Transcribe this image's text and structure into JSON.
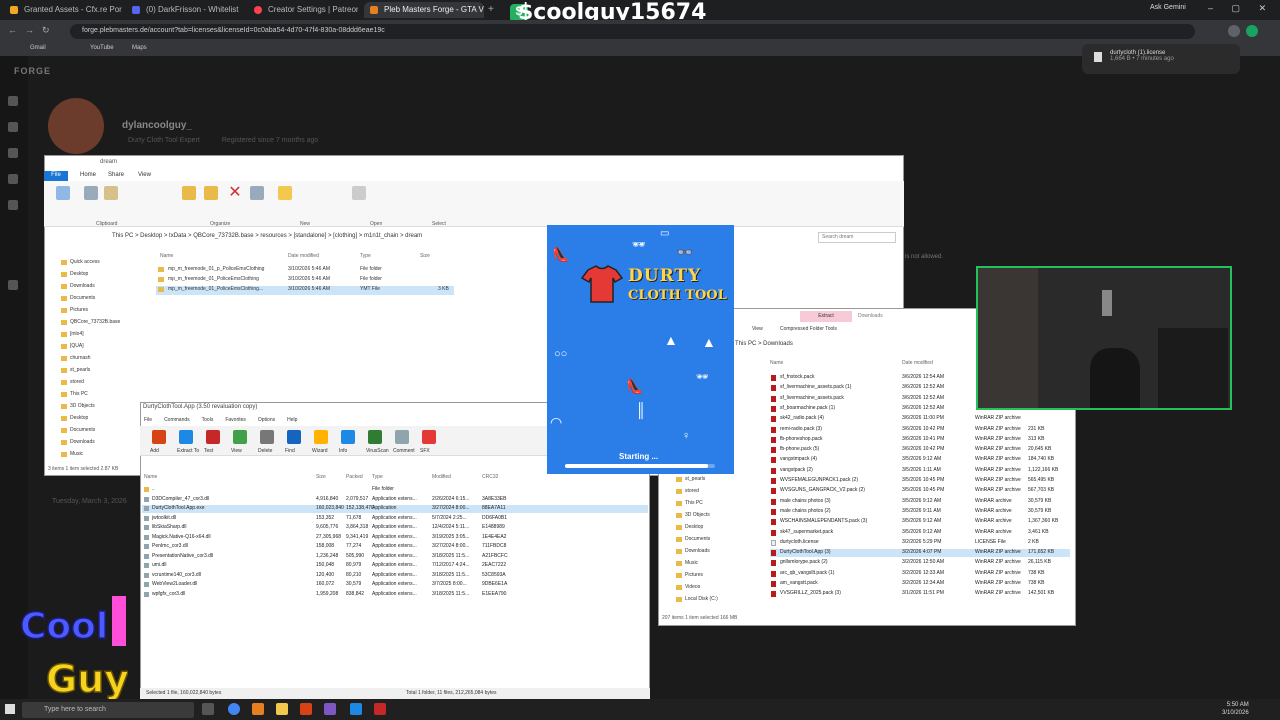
{
  "browser": {
    "tabs": [
      {
        "label": "Granted Assets - Cfx.re Portal",
        "color": "#f5a623"
      },
      {
        "label": "(0) DarkFrisson - Whitelist",
        "color": "#5865f2"
      },
      {
        "label": "Creator Settings | Patreon",
        "color": "#ff424d"
      },
      {
        "label": "Pleb Masters Forge - GTA V Du...",
        "color": "#e67e22",
        "active": true
      }
    ],
    "url": "forge.plebmasters.de/account?tab=licenses&licenseId=0c0aba54-4d70-47f4-830a-08ddd6eae19c",
    "bookmarks": [
      "Gmail",
      "YouTube",
      "Maps"
    ],
    "ask_gemini": "Ask Gemini"
  },
  "overlay": {
    "username": "$coolguy15674",
    "dollar": "$",
    "logo_top": "Cool",
    "logo_bottom": "Guy"
  },
  "site": {
    "logo": "FORGE",
    "profile_name": "dylancoolguy_",
    "badge": "Durty Cloth Tool Expert",
    "registered": "Registered since 7 months ago",
    "not_allowed": "is not allowed."
  },
  "download_popup": {
    "file": "durtycloth (1).license",
    "meta": "1,664 B • 7 minutes ago"
  },
  "explorer1": {
    "title": "dream",
    "ribbon_tabs": [
      "File",
      "Home",
      "Share",
      "View"
    ],
    "ribbon_groups": [
      "Clipboard",
      "Organize",
      "New",
      "Open",
      "Select"
    ],
    "ribbon_buttons": [
      "Pin to Quick access",
      "Copy",
      "Paste",
      "Move to",
      "Copy to",
      "Delete",
      "Rename",
      "New folder",
      "Properties"
    ],
    "path": "This PC  >  Desktop  >  txData  >  QBCore_73732B.base  >  resources  >  [standalone]  >  [clothing]  >  m1n1t_chain  >  dream",
    "search_placeholder": "Search dream",
    "nav": [
      "Quick access",
      "Desktop",
      "Downloads",
      "Documents",
      "Pictures",
      "QBCore_73732B.base",
      "[mlo4]",
      "[QUA]",
      "churnash",
      "st_pearls",
      "stored",
      "This PC",
      "3D Objects",
      "Desktop",
      "Documents",
      "Downloads",
      "Music"
    ],
    "columns": [
      "Name",
      "Date modified",
      "Type",
      "Size"
    ],
    "files": [
      {
        "name": "mp_m_freemode_01_p_PoliceEmsClothing",
        "date": "3/10/2026 5:46 AM",
        "type": "File folder",
        "size": ""
      },
      {
        "name": "mp_m_freemode_01_PoliceEmsClothing",
        "date": "3/10/2026 5:46 AM",
        "type": "File folder",
        "size": ""
      },
      {
        "name": "mp_m_freemode_01_PoliceEmsClothing...",
        "date": "3/10/2026 5:46 AM",
        "type": "YMT File",
        "size": "3 KB"
      }
    ],
    "status": "3 items    1 item selected  2.87 KB"
  },
  "dct": {
    "title": "DurtyClothTool.App (3.50 revaluation copy)",
    "menu": [
      "File",
      "Commands",
      "Tools",
      "Favorites",
      "Options",
      "Help"
    ],
    "toolbar": [
      "Add",
      "Extract To",
      "Test",
      "View",
      "Delete",
      "Find",
      "Wizard",
      "Info",
      "VirusScan",
      "Comment",
      "SFX"
    ],
    "columns": [
      "Name",
      "Size",
      "Packed",
      "Type",
      "Modified",
      "CRC32"
    ],
    "rows": [
      {
        "name": "..",
        "size": "",
        "packed": "",
        "type": "File folder",
        "modified": "",
        "crc": ""
      },
      {
        "name": "D3DCompiler_47_cor3.dll",
        "size": "4,916,840",
        "packed": "2,079,517",
        "type": "Application extens...",
        "modified": "2/26/2024 6:15...",
        "crc": "3A8E33EB"
      },
      {
        "name": "DurtyClothTool.App.exe",
        "size": "160,023,840",
        "packed": "152,138,470",
        "type": "Application",
        "modified": "3/27/2024 8:00...",
        "crc": "88EA7A11"
      },
      {
        "name": "jwtoolkit.dll",
        "size": "153,352",
        "packed": "71,678",
        "type": "Application extens...",
        "modified": "5/7/2024 2:25...",
        "crc": "DD6FA0B1"
      },
      {
        "name": "libSkiaSharp.dll",
        "size": "9,605,776",
        "packed": "3,864,318",
        "type": "Application extens...",
        "modified": "12/4/2024 5:11...",
        "crc": "E1488989"
      },
      {
        "name": "Magick.Native-Q16-x64.dll",
        "size": "27,305,968",
        "packed": "9,341,419",
        "type": "Application extens...",
        "modified": "3/19/2025 3:05...",
        "crc": "1E4E4EA2"
      },
      {
        "name": "PenImc_cor3.dll",
        "size": "158,008",
        "packed": "77,274",
        "type": "Application extens...",
        "modified": "3/27/2024 8:00...",
        "crc": "711FBDC8"
      },
      {
        "name": "PresentationNative_cor3.dll",
        "size": "1,236,248",
        "packed": "505,990",
        "type": "Application extens...",
        "modified": "3/18/2025 11:5...",
        "crc": "A21FBCFC"
      },
      {
        "name": "umi.dll",
        "size": "150,048",
        "packed": "80,979",
        "type": "Application extens...",
        "modified": "7/12/2017 4:24...",
        "crc": "2EAC7222"
      },
      {
        "name": "vcruntime140_cor3.dll",
        "size": "120,400",
        "packed": "80,210",
        "type": "Application extens...",
        "modified": "3/18/2025 11:5...",
        "crc": "53C8593A"
      },
      {
        "name": "WebView2Loader.dll",
        "size": "160,072",
        "packed": "30,579",
        "type": "Application extens...",
        "modified": "3/7/2025 8:00...",
        "crc": "9DBE6E1A"
      },
      {
        "name": "wpfgfx_cor3.dll",
        "size": "1,959,208",
        "packed": "838,842",
        "type": "Application extens...",
        "modified": "3/18/2025 11:5...",
        "crc": "E1EEA790"
      }
    ],
    "status_left": "Selected 1 file, 160,022,840 bytes",
    "status_right": "Total 1 folder, 11 files, 212,265,084 bytes"
  },
  "splash": {
    "title_line1": "DURTY",
    "title_line2": "CLOTH TOOL",
    "status": "Starting ...",
    "progress": 0.95
  },
  "explorer2": {
    "extract_tab": "Extract",
    "downloads_tab": "Downloads",
    "ribbon": [
      "View",
      "Compressed Folder Tools"
    ],
    "path": "This PC  >  Downloads",
    "columns": [
      "Name",
      "Date modified",
      "Type",
      "Size"
    ],
    "nav": [
      "st_pearls",
      "stored",
      "This PC",
      "3D Objects",
      "Desktop",
      "Documents",
      "Downloads",
      "Music",
      "Pictures",
      "Videos",
      "Local Disk (C:)"
    ],
    "rows": [
      {
        "name": "sf_fnstock.pack",
        "date": "3/6/2026 12:54 AM",
        "type": "",
        "size": ""
      },
      {
        "name": "sf_livermachine_assets.pack (1)",
        "date": "3/6/2026 12:52 AM",
        "type": "",
        "size": ""
      },
      {
        "name": "sf_livermachine_assets.pack",
        "date": "3/6/2026 12:52 AM",
        "type": "",
        "size": ""
      },
      {
        "name": "sf_boarmachine.pack (1)",
        "date": "3/6/2026 12:52 AM",
        "type": "",
        "size": ""
      },
      {
        "name": "sk42_radio.pack (4)",
        "date": "3/6/2026 11:00 PM",
        "type": "WinRAR ZIP archive",
        "size": ""
      },
      {
        "name": "remi-radio.pack (3)",
        "date": "3/6/2026 10:42 PM",
        "type": "WinRAR ZIP archive",
        "size": "231 KB"
      },
      {
        "name": "fb-phoneshop.pack",
        "date": "3/6/2026 10:41 PM",
        "type": "WinRAR ZIP archive",
        "size": "313 KB"
      },
      {
        "name": "fb-phone.pack (5)",
        "date": "3/6/2026 10:42 PM",
        "type": "WinRAR ZIP archive",
        "size": "20,645 KB"
      },
      {
        "name": "vangstmpack (4)",
        "date": "3/5/2026 9:12 AM",
        "type": "WinRAR ZIP archive",
        "size": "184,740 KB"
      },
      {
        "name": "vangstpack (2)",
        "date": "3/5/2026 1:11 AM",
        "type": "WinRAR ZIP archive",
        "size": "1,122,166 KB"
      },
      {
        "name": "WVSFEMALEGUNPACK1.pack (2)",
        "date": "3/5/2026 10:45 PM",
        "type": "WinRAR ZIP archive",
        "size": "565,495 KB"
      },
      {
        "name": "WVSGUNS_GANGPACK_V2.pack (2)",
        "date": "3/5/2026 10:45 PM",
        "type": "WinRAR ZIP archive",
        "size": "567,703 KB"
      },
      {
        "name": "male chains photos (3)",
        "date": "3/5/2026 9:12 AM",
        "type": "WinRAR archive",
        "size": "30,579 KB"
      },
      {
        "name": "male chains photos (2)",
        "date": "3/5/2026 9:11 AM",
        "type": "WinRAR archive",
        "size": "30,579 KB"
      },
      {
        "name": "WSCHAINSMALEPENDANTS.pack (3)",
        "date": "3/5/2026 9:12 AM",
        "type": "WinRAR archive",
        "size": "1,367,360 KB"
      },
      {
        "name": "sk47_supermarket.pack",
        "date": "3/5/2026 9:12 AM",
        "type": "WinRAR archive",
        "size": "3,461 KB"
      },
      {
        "name": "durtycloth.license",
        "date": "3/2/2026 5:29 PM",
        "type": "LICENSE File",
        "size": "2 KB"
      },
      {
        "name": "DurtyClothTool.App (3)",
        "date": "3/2/2026 4:07 PM",
        "type": "WinRAR ZIP archive",
        "size": "171,652 KB",
        "selected": true
      },
      {
        "name": "gnllsmlorype.pack (2)",
        "date": "3/2/2026 12:50 AM",
        "type": "WinRAR ZIP archive",
        "size": "26,115 KB"
      },
      {
        "name": "arc_qb_vangsllt.pack (1)",
        "date": "3/2/2026 12:33 AM",
        "type": "WinRAR ZIP archive",
        "size": "738 KB"
      },
      {
        "name": "am_vangstt.pack",
        "date": "3/2/2026 12:34 AM",
        "type": "WinRAR ZIP archive",
        "size": "738 KB"
      },
      {
        "name": "VVSGRILLZ_2025.pack (3)",
        "date": "3/1/2026 11:51 PM",
        "type": "WinRAR ZIP archive",
        "size": "142,501 KB"
      }
    ],
    "status": "207 items    1 item selected  166 MB"
  },
  "ghost_date": "Tuesday, March 3, 2026",
  "taskbar": {
    "search_placeholder": "Type here to search",
    "time": "5:50 AM",
    "date": "3/10/2026"
  }
}
